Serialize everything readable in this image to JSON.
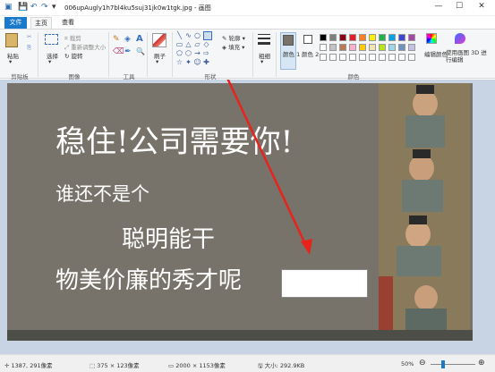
{
  "window": {
    "title": "006upAugly1h7bl4ku5suj31jk0w1tgk.jpg - 画图",
    "minimize": "—",
    "maximize": "☐",
    "close": "✕"
  },
  "quick_access": {
    "save": "💾",
    "undo": "↶",
    "redo": "↷",
    "dropdown": "▾"
  },
  "tabs": {
    "file": "文件",
    "home": "主页",
    "view": "查看"
  },
  "ribbon": {
    "clipboard": {
      "paste": "粘贴",
      "cut": "✂",
      "copy": "⎘",
      "label": "剪贴板"
    },
    "image": {
      "select": "选择",
      "crop": "裁剪",
      "resize": "重新调整大小",
      "rotate": "旋转",
      "label": "图像"
    },
    "tools": {
      "label": "工具",
      "pencil": "✎",
      "fill": "◈",
      "text": "A",
      "eraser": "⌫",
      "picker": "✒",
      "magnifier": "🔍"
    },
    "brushes": {
      "label": "刷子"
    },
    "shapes": {
      "label": "形状",
      "outline": "轮廓",
      "fill": "填充",
      "grid": [
        "╲",
        "∿",
        "○",
        "□",
        "▭",
        "△",
        "▱",
        "◇",
        "⬠",
        "⬡",
        "→",
        "⇨",
        "☆",
        "✦",
        "☺",
        "✚"
      ]
    },
    "size": {
      "label": "粗细"
    },
    "colors": {
      "color1": "颜色 1",
      "color2": "颜色 2",
      "label": "颜色",
      "edit": "编辑颜色",
      "paint3d": "使用画图 3D 进行编辑",
      "palette_row1": [
        "#000000",
        "#7f7f7f",
        "#880015",
        "#ed1c24",
        "#ff7f27",
        "#fff200",
        "#22b14c",
        "#00a2e8",
        "#3f48cc",
        "#a349a4"
      ],
      "palette_row2": [
        "#ffffff",
        "#c3c3c3",
        "#b97a57",
        "#ffaec9",
        "#ffc90e",
        "#efe4b0",
        "#b5e61d",
        "#99d9ea",
        "#7092be",
        "#c8bfe7"
      ],
      "color1_value": "#77736a",
      "color2_value": "#ffffff"
    }
  },
  "canvas": {
    "line1": "稳住!公司需要你!",
    "line2": "谁还不是个",
    "line3": "聪明能干",
    "line4": "物美价廉的秀才呢",
    "strip_background": "#8a7a5c"
  },
  "status": {
    "cursor": "1387, 291像素",
    "selection": "375 × 123像素",
    "image_size": "2000 × 1153像素",
    "file_size": "大小: 292.9KB",
    "zoom": "50%",
    "zoom_minus": "⊖",
    "zoom_plus": "⊕"
  }
}
